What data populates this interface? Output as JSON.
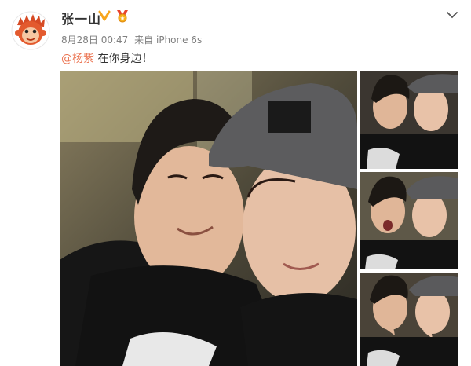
{
  "post": {
    "username": "张一山",
    "time": "8月28日 00:47",
    "source_prefix": "来自",
    "source_device": "iPhone 6s",
    "mention": "@杨紫",
    "text": "在你身边！"
  },
  "icons": {
    "avatar": "monkey-avatar",
    "verified": "verified-v-badge-icon",
    "medal": "medal-icon",
    "menu": "chevron-down-icon"
  },
  "colors": {
    "mention": "#eb7350",
    "verified": "#f7a51c",
    "meta": "#808080",
    "username": "#333333"
  }
}
